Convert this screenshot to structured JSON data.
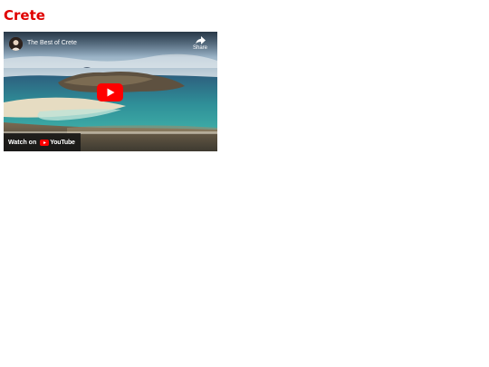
{
  "page": {
    "title": "Crete",
    "title_color": "#e00000"
  },
  "video": {
    "title": "The Best of Crete",
    "share_label": "Share",
    "watch_on_label": "Watch on",
    "platform_logo_text": "YouTube",
    "play_button_color": "#ff0000",
    "icons": {
      "avatar": "channel-avatar",
      "share": "share-arrow-icon",
      "play": "play-icon",
      "logo": "youtube-logo-icon"
    }
  }
}
